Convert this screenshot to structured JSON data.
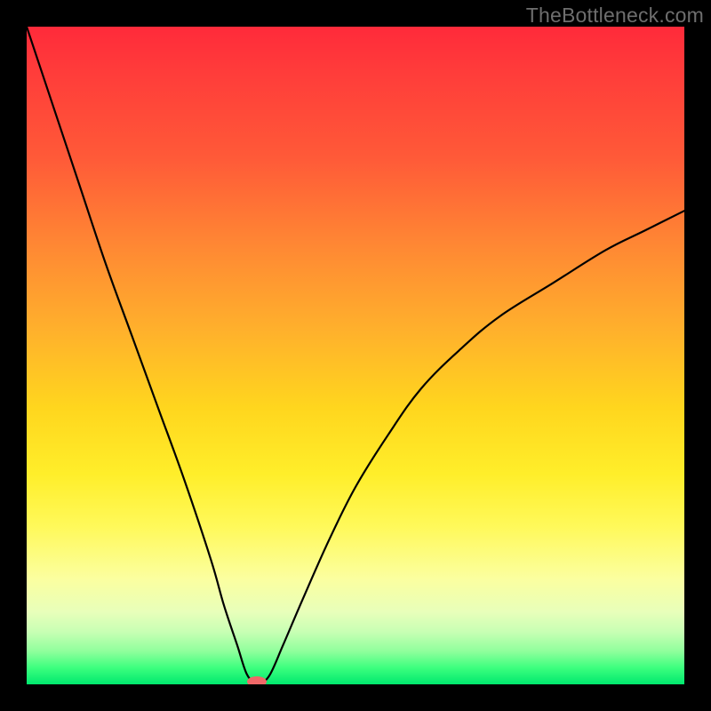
{
  "watermark": "TheBottleneck.com",
  "chart_data": {
    "type": "line",
    "title": "",
    "xlabel": "",
    "ylabel": "",
    "xlim": [
      0,
      1
    ],
    "ylim": [
      0,
      100
    ],
    "grid": false,
    "legend": false,
    "series": [
      {
        "name": "curve",
        "x": [
          0.0,
          0.04,
          0.08,
          0.12,
          0.16,
          0.2,
          0.24,
          0.28,
          0.3,
          0.32,
          0.335,
          0.35,
          0.355,
          0.37,
          0.39,
          0.42,
          0.46,
          0.5,
          0.55,
          0.6,
          0.66,
          0.72,
          0.8,
          0.88,
          0.94,
          1.0
        ],
        "y": [
          100,
          88,
          76,
          64,
          53,
          42,
          31,
          19,
          12,
          6,
          1.5,
          0,
          0,
          1.5,
          6,
          13,
          22,
          30,
          38,
          45,
          51,
          56,
          61,
          66,
          69,
          72
        ]
      }
    ],
    "markers": [
      {
        "name": "vertex-marker",
        "x": 0.35,
        "y": 0,
        "color": "#f06868"
      }
    ],
    "background_gradient_stops": [
      {
        "pct": 0,
        "color": "#ff2a3a"
      },
      {
        "pct": 20,
        "color": "#ff5a38"
      },
      {
        "pct": 46,
        "color": "#ffb02c"
      },
      {
        "pct": 68,
        "color": "#ffee2a"
      },
      {
        "pct": 89,
        "color": "#e8ffba"
      },
      {
        "pct": 100,
        "color": "#00e86e"
      }
    ]
  }
}
